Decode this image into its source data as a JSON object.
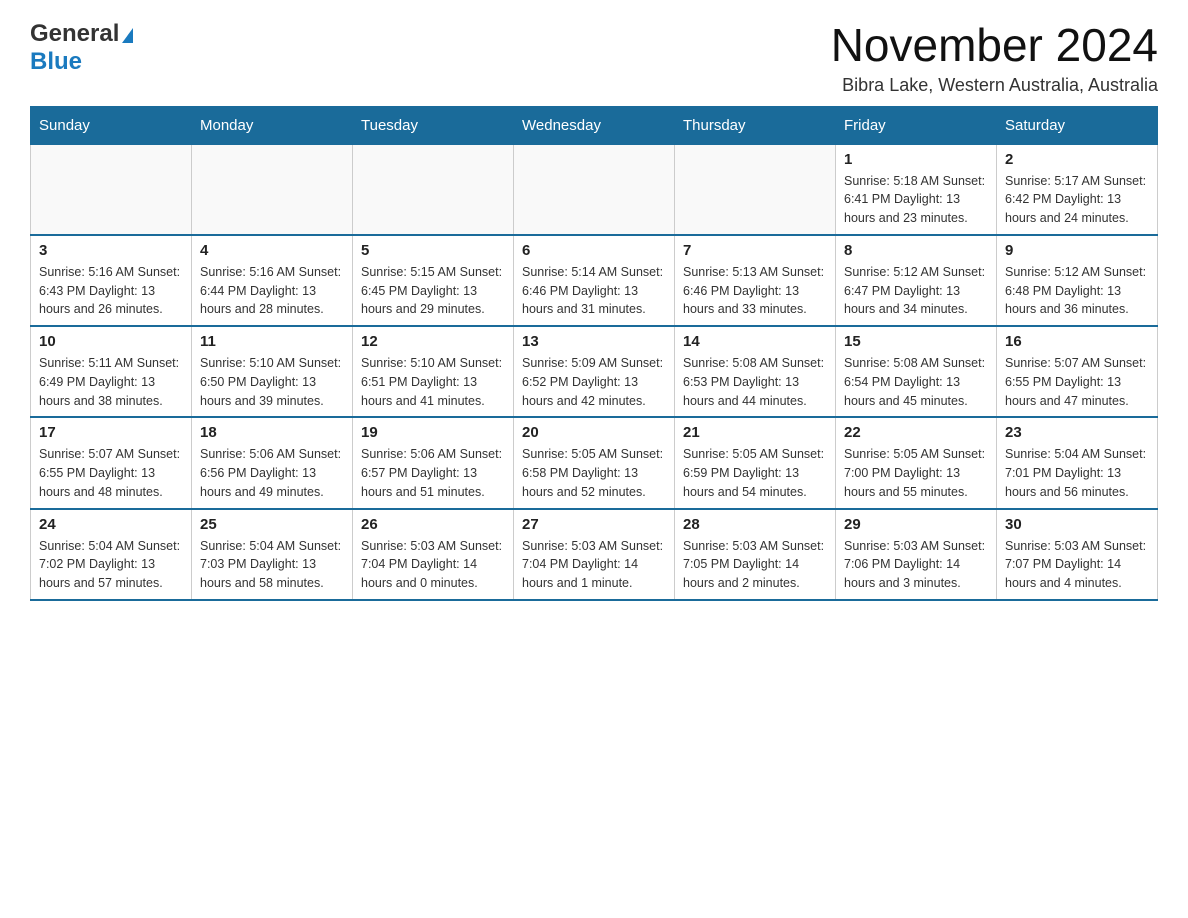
{
  "logo": {
    "general": "General",
    "blue": "Blue",
    "triangle": "▶"
  },
  "title": "November 2024",
  "subtitle": "Bibra Lake, Western Australia, Australia",
  "days_of_week": [
    "Sunday",
    "Monday",
    "Tuesday",
    "Wednesday",
    "Thursday",
    "Friday",
    "Saturday"
  ],
  "weeks": [
    [
      {
        "day": "",
        "info": ""
      },
      {
        "day": "",
        "info": ""
      },
      {
        "day": "",
        "info": ""
      },
      {
        "day": "",
        "info": ""
      },
      {
        "day": "",
        "info": ""
      },
      {
        "day": "1",
        "info": "Sunrise: 5:18 AM\nSunset: 6:41 PM\nDaylight: 13 hours and 23 minutes."
      },
      {
        "day": "2",
        "info": "Sunrise: 5:17 AM\nSunset: 6:42 PM\nDaylight: 13 hours and 24 minutes."
      }
    ],
    [
      {
        "day": "3",
        "info": "Sunrise: 5:16 AM\nSunset: 6:43 PM\nDaylight: 13 hours and 26 minutes."
      },
      {
        "day": "4",
        "info": "Sunrise: 5:16 AM\nSunset: 6:44 PM\nDaylight: 13 hours and 28 minutes."
      },
      {
        "day": "5",
        "info": "Sunrise: 5:15 AM\nSunset: 6:45 PM\nDaylight: 13 hours and 29 minutes."
      },
      {
        "day": "6",
        "info": "Sunrise: 5:14 AM\nSunset: 6:46 PM\nDaylight: 13 hours and 31 minutes."
      },
      {
        "day": "7",
        "info": "Sunrise: 5:13 AM\nSunset: 6:46 PM\nDaylight: 13 hours and 33 minutes."
      },
      {
        "day": "8",
        "info": "Sunrise: 5:12 AM\nSunset: 6:47 PM\nDaylight: 13 hours and 34 minutes."
      },
      {
        "day": "9",
        "info": "Sunrise: 5:12 AM\nSunset: 6:48 PM\nDaylight: 13 hours and 36 minutes."
      }
    ],
    [
      {
        "day": "10",
        "info": "Sunrise: 5:11 AM\nSunset: 6:49 PM\nDaylight: 13 hours and 38 minutes."
      },
      {
        "day": "11",
        "info": "Sunrise: 5:10 AM\nSunset: 6:50 PM\nDaylight: 13 hours and 39 minutes."
      },
      {
        "day": "12",
        "info": "Sunrise: 5:10 AM\nSunset: 6:51 PM\nDaylight: 13 hours and 41 minutes."
      },
      {
        "day": "13",
        "info": "Sunrise: 5:09 AM\nSunset: 6:52 PM\nDaylight: 13 hours and 42 minutes."
      },
      {
        "day": "14",
        "info": "Sunrise: 5:08 AM\nSunset: 6:53 PM\nDaylight: 13 hours and 44 minutes."
      },
      {
        "day": "15",
        "info": "Sunrise: 5:08 AM\nSunset: 6:54 PM\nDaylight: 13 hours and 45 minutes."
      },
      {
        "day": "16",
        "info": "Sunrise: 5:07 AM\nSunset: 6:55 PM\nDaylight: 13 hours and 47 minutes."
      }
    ],
    [
      {
        "day": "17",
        "info": "Sunrise: 5:07 AM\nSunset: 6:55 PM\nDaylight: 13 hours and 48 minutes."
      },
      {
        "day": "18",
        "info": "Sunrise: 5:06 AM\nSunset: 6:56 PM\nDaylight: 13 hours and 49 minutes."
      },
      {
        "day": "19",
        "info": "Sunrise: 5:06 AM\nSunset: 6:57 PM\nDaylight: 13 hours and 51 minutes."
      },
      {
        "day": "20",
        "info": "Sunrise: 5:05 AM\nSunset: 6:58 PM\nDaylight: 13 hours and 52 minutes."
      },
      {
        "day": "21",
        "info": "Sunrise: 5:05 AM\nSunset: 6:59 PM\nDaylight: 13 hours and 54 minutes."
      },
      {
        "day": "22",
        "info": "Sunrise: 5:05 AM\nSunset: 7:00 PM\nDaylight: 13 hours and 55 minutes."
      },
      {
        "day": "23",
        "info": "Sunrise: 5:04 AM\nSunset: 7:01 PM\nDaylight: 13 hours and 56 minutes."
      }
    ],
    [
      {
        "day": "24",
        "info": "Sunrise: 5:04 AM\nSunset: 7:02 PM\nDaylight: 13 hours and 57 minutes."
      },
      {
        "day": "25",
        "info": "Sunrise: 5:04 AM\nSunset: 7:03 PM\nDaylight: 13 hours and 58 minutes."
      },
      {
        "day": "26",
        "info": "Sunrise: 5:03 AM\nSunset: 7:04 PM\nDaylight: 14 hours and 0 minutes."
      },
      {
        "day": "27",
        "info": "Sunrise: 5:03 AM\nSunset: 7:04 PM\nDaylight: 14 hours and 1 minute."
      },
      {
        "day": "28",
        "info": "Sunrise: 5:03 AM\nSunset: 7:05 PM\nDaylight: 14 hours and 2 minutes."
      },
      {
        "day": "29",
        "info": "Sunrise: 5:03 AM\nSunset: 7:06 PM\nDaylight: 14 hours and 3 minutes."
      },
      {
        "day": "30",
        "info": "Sunrise: 5:03 AM\nSunset: 7:07 PM\nDaylight: 14 hours and 4 minutes."
      }
    ]
  ]
}
